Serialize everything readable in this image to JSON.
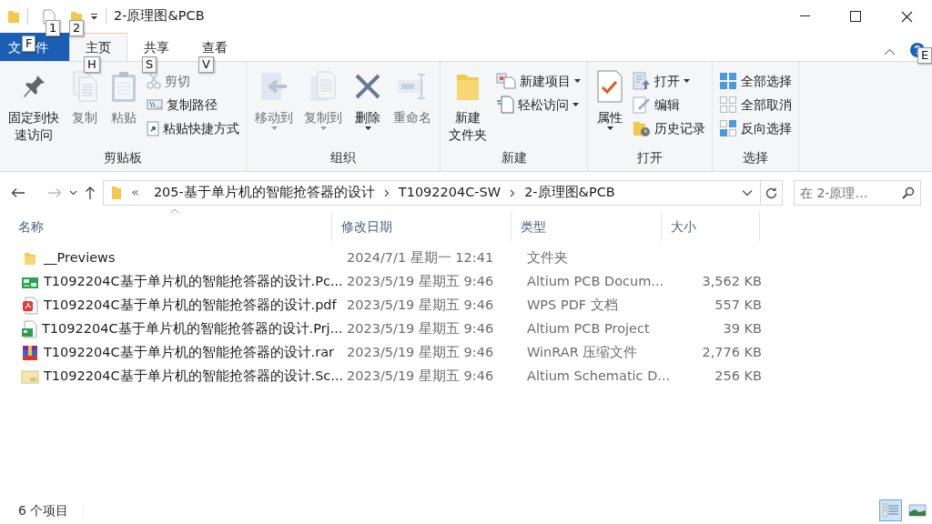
{
  "window": {
    "title": "2-原理图&PCB"
  },
  "keytips": [
    "1",
    "2",
    "F",
    "H",
    "S",
    "V",
    "E"
  ],
  "ribbon": {
    "tabs": [
      {
        "label": "文件",
        "kind": "file",
        "selected": false
      },
      {
        "label": "主页",
        "kind": "tab",
        "selected": true
      },
      {
        "label": "共享",
        "kind": "tab",
        "selected": false
      },
      {
        "label": "查看",
        "kind": "tab",
        "selected": false
      }
    ],
    "groups": [
      {
        "label": "剪贴板",
        "items": [
          {
            "kind": "large",
            "lines": [
              "固定到快",
              "速访问"
            ],
            "disabled": false,
            "menu": false
          },
          {
            "kind": "large",
            "lines": [
              "复制"
            ],
            "disabled": true,
            "menu": false
          },
          {
            "kind": "large",
            "lines": [
              "粘贴"
            ],
            "disabled": true,
            "menu": false
          },
          {
            "kind": "small",
            "label": "剪切",
            "disabled": true,
            "menu": false
          },
          {
            "kind": "small",
            "label": "复制路径",
            "disabled": false,
            "menu": false
          },
          {
            "kind": "small",
            "label": "粘贴快捷方式",
            "disabled": false,
            "menu": false
          }
        ]
      },
      {
        "label": "组织",
        "items": [
          {
            "kind": "large",
            "lines": [
              "移动到"
            ],
            "disabled": true,
            "menu": true
          },
          {
            "kind": "large",
            "lines": [
              "复制到"
            ],
            "disabled": true,
            "menu": true
          },
          {
            "kind": "large",
            "lines": [
              "删除"
            ],
            "disabled": false,
            "menu": true
          },
          {
            "kind": "large",
            "lines": [
              "重命名"
            ],
            "disabled": true,
            "menu": false
          }
        ]
      },
      {
        "label": "新建",
        "items": [
          {
            "kind": "large",
            "lines": [
              "新建",
              "文件夹"
            ],
            "disabled": false,
            "menu": false
          },
          {
            "kind": "small",
            "label": "新建项目",
            "disabled": false,
            "menu": true
          },
          {
            "kind": "small",
            "label": "轻松访问",
            "disabled": false,
            "menu": true
          }
        ]
      },
      {
        "label": "打开",
        "items": [
          {
            "kind": "large",
            "lines": [
              "属性"
            ],
            "disabled": false,
            "menu": true
          },
          {
            "kind": "small",
            "label": "打开",
            "disabled": false,
            "menu": true
          },
          {
            "kind": "small",
            "label": "编辑",
            "disabled": false,
            "menu": false
          },
          {
            "kind": "small",
            "label": "历史记录",
            "disabled": false,
            "menu": false
          }
        ]
      },
      {
        "label": "选择",
        "items": [
          {
            "kind": "small",
            "label": "全部选择",
            "disabled": false,
            "menu": false
          },
          {
            "kind": "small",
            "label": "全部取消",
            "disabled": false,
            "menu": false
          },
          {
            "kind": "small",
            "label": "反向选择",
            "disabled": false,
            "menu": false
          }
        ]
      }
    ]
  },
  "address_bar": {
    "overflow": "«",
    "path": [
      "205-基于单片机的智能抢答器的设计",
      "T1092204C-SW",
      "2-原理图&PCB"
    ]
  },
  "search": {
    "placeholder": "在 2-原理…"
  },
  "table": {
    "columns": [
      {
        "label": "名称",
        "sorted": true
      },
      {
        "label": "修改日期",
        "sorted": false
      },
      {
        "label": "类型",
        "sorted": false
      },
      {
        "label": "大小",
        "sorted": false
      }
    ],
    "rows": [
      {
        "kind": "folder",
        "name": "__Previews",
        "date": "2024/7/1 星期一 12:41",
        "type": "文件夹",
        "size": ""
      },
      {
        "kind": "pcb",
        "name": "T1092204C基于单片机的智能抢答器的设计.Pc...",
        "date": "2023/5/19 星期五 9:46",
        "type": "Altium PCB Docum...",
        "size": "3,562 KB"
      },
      {
        "kind": "pdf",
        "name": "T1092204C基于单片机的智能抢答器的设计.pdf",
        "date": "2023/5/19 星期五 9:46",
        "type": "WPS PDF 文档",
        "size": "557 KB"
      },
      {
        "kind": "project",
        "name": "T1092204C基于单片机的智能抢答器的设计.Prj...",
        "date": "2023/5/19 星期五 9:46",
        "type": "Altium PCB Project",
        "size": "39 KB"
      },
      {
        "kind": "rar",
        "name": "T1092204C基于单片机的智能抢答器的设计.rar",
        "date": "2023/5/19 星期五 9:46",
        "type": "WinRAR 压缩文件",
        "size": "2,776 KB"
      },
      {
        "kind": "schematic",
        "name": "T1092204C基于单片机的智能抢答器的设计.Sc...",
        "date": "2023/5/19 星期五 9:46",
        "type": "Altium Schematic D...",
        "size": "256 KB"
      }
    ]
  },
  "status_bar": {
    "count": "6 个项目",
    "views": [
      {
        "kind": "details",
        "selected": true
      },
      {
        "kind": "large-icons",
        "selected": false
      }
    ]
  }
}
